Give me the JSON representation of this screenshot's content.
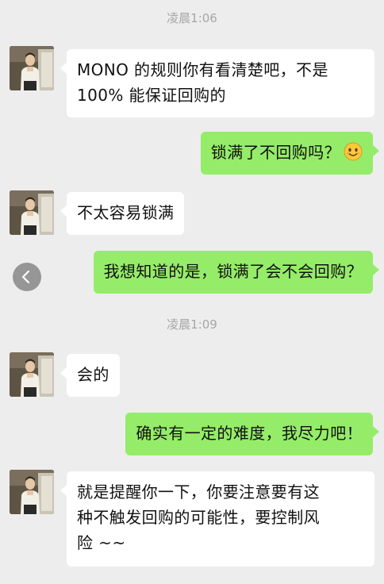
{
  "timestamps": [
    "凌晨1:06",
    "凌晨1:09"
  ],
  "messages": [
    {
      "from": "contact",
      "lines": [
        "MONO 的规则你有看清楚吧，不是",
        "100% 能保证回购的"
      ]
    },
    {
      "from": "me",
      "text": "锁满了不回购吗？",
      "emoji": "smiling-face-emoji"
    },
    {
      "from": "contact",
      "text": "不太容易锁满"
    },
    {
      "from": "me",
      "text": "我想知道的是，锁满了会不会回购？"
    },
    {
      "from": "contact",
      "text": "会的"
    },
    {
      "from": "me",
      "text": "确实有一定的难度，我尽力吧！"
    },
    {
      "from": "contact",
      "lines": [
        "就是提醒你一下，你要注意要有这",
        "种不触发回购的可能性，要控制风",
        "险 ~~"
      ]
    }
  ],
  "icons": {
    "back": "chevron-left-icon",
    "avatar": "contact-avatar"
  },
  "colors": {
    "background": "#ededed",
    "incoming_bubble": "#ffffff",
    "outgoing_bubble": "#95ec69",
    "timestamp": "#a6a6a6"
  }
}
